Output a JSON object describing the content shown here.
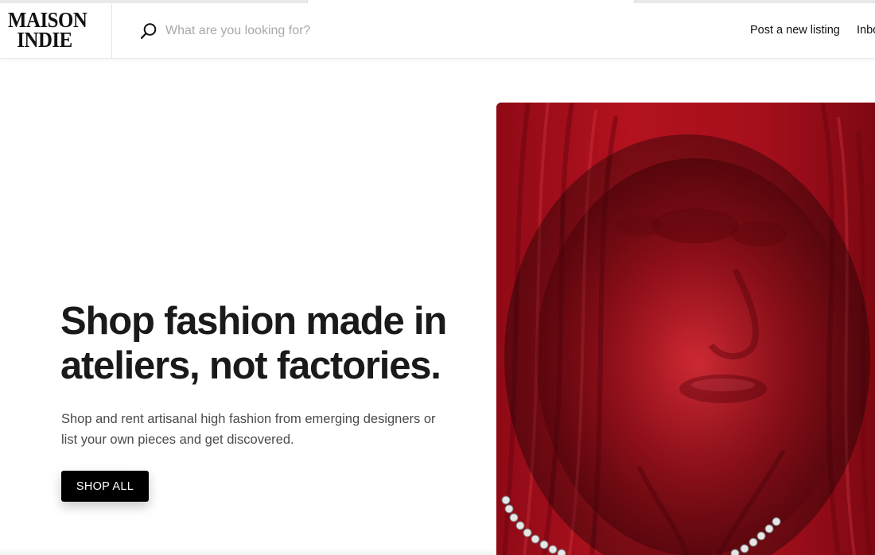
{
  "brand": {
    "logo_line1": "MAISON",
    "logo_line2": "INDIE"
  },
  "search": {
    "placeholder": "What are you looking for?",
    "icon": "search-icon"
  },
  "nav": {
    "post_listing": "Post a new listing",
    "inbox": "Inbo"
  },
  "hero": {
    "title_line1": "Shop fashion made in",
    "title_line2": "ateliers, not factories.",
    "subtitle_line1": "Shop and rent artisanal high fashion from emerging designers or",
    "subtitle_line2": "list your own pieces and get discovered.",
    "cta_label": "SHOP ALL",
    "image": "photo of a person with head wrapped in red sheer fabric and a silver chain necklace"
  },
  "colors": {
    "accent_red": "#b3121e",
    "button_bg": "#000000",
    "text_primary": "#1a1a1a",
    "text_secondary": "#4a4a4a",
    "placeholder": "#a9a9a9"
  }
}
